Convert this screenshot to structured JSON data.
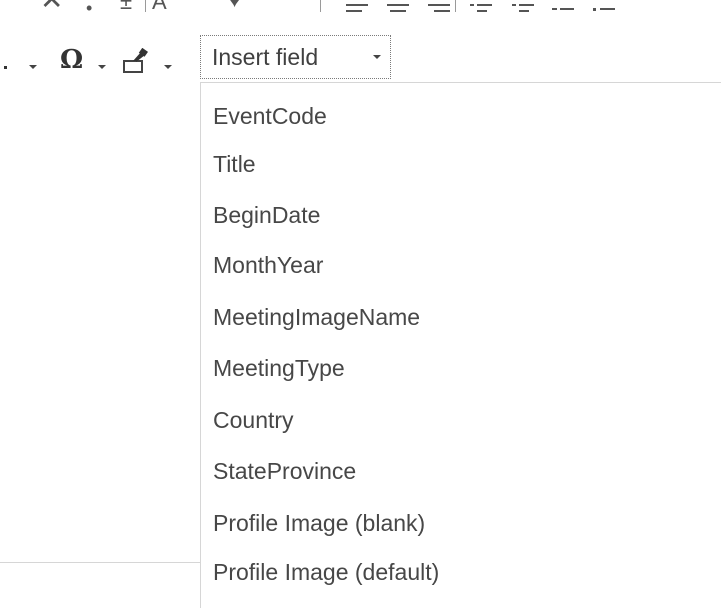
{
  "toolbar": {
    "insert_field_label": "Insert field",
    "special_char_glyph": "Ω",
    "icons": {
      "special_character": "omega-icon",
      "format_painter": "brush-icon",
      "align_left": "align-left-icon",
      "align_center": "align-center-icon",
      "align_right": "align-right-icon",
      "indent": "indent-icon",
      "outdent": "outdent-icon",
      "numbered_list": "numbered-list-icon",
      "bulleted_list": "bulleted-list-icon"
    }
  },
  "dropdown": {
    "items": [
      "EventCode",
      "Title",
      "BeginDate",
      "MonthYear",
      "MeetingImageName",
      "MeetingType",
      "Country",
      "StateProvince",
      "Profile Image (blank)",
      "Profile Image (default)"
    ]
  },
  "colors": {
    "text": "#404040",
    "border": "#d6d6d6",
    "icon": "#444444"
  }
}
